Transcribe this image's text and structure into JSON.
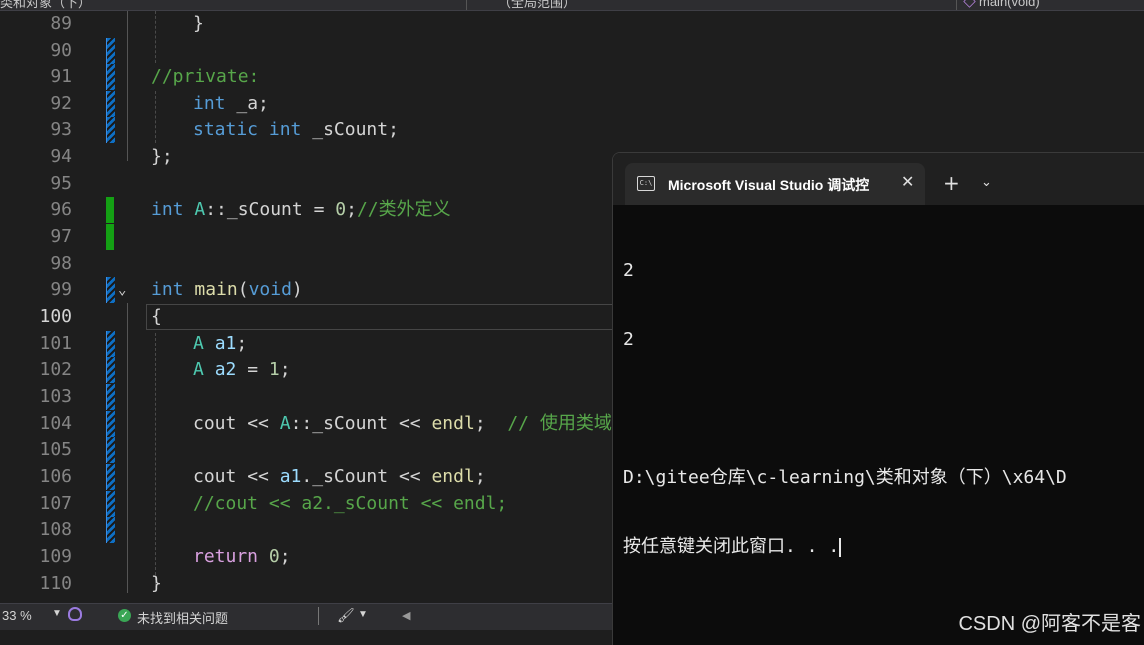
{
  "nav": {
    "class_combo": "类和对象（下）",
    "scope_combo": "（全局范围）",
    "member_combo": "main(void)"
  },
  "editor": {
    "current_line": "100",
    "lines": [
      {
        "n": "89"
      },
      {
        "n": "90"
      },
      {
        "n": "91"
      },
      {
        "n": "92"
      },
      {
        "n": "93"
      },
      {
        "n": "94"
      },
      {
        "n": "95"
      },
      {
        "n": "96"
      },
      {
        "n": "97"
      },
      {
        "n": "98"
      },
      {
        "n": "99"
      },
      {
        "n": "100"
      },
      {
        "n": "101"
      },
      {
        "n": "102"
      },
      {
        "n": "103"
      },
      {
        "n": "104"
      },
      {
        "n": "105"
      },
      {
        "n": "106"
      },
      {
        "n": "107"
      },
      {
        "n": "108"
      },
      {
        "n": "109"
      },
      {
        "n": "110"
      }
    ],
    "code": {
      "l89_brace": "}",
      "l91_comment": "//private:",
      "l92_kw": "int",
      "l92_rest": " _a;",
      "l93_kw1": "static",
      "l93_kw2": "int",
      "l93_rest": " _sCount;",
      "l94": "};",
      "l96_kw": "int",
      "l96_type": "A",
      "l96_rest": "::_sCount = ",
      "l96_num": "0",
      "l96_semi": ";",
      "l96_comment": "//类外定义",
      "l99_kw": "int",
      "l99_fn": "main",
      "l99_open": "(",
      "l99_void": "void",
      "l99_close": ")",
      "l100": "{",
      "l101_type": "A",
      "l101_var": "a1",
      "l101_semi": ";",
      "l102_type": "A",
      "l102_var": "a2",
      "l102_eq": " = ",
      "l102_num": "1",
      "l102_semi": ";",
      "l104_cout": "cout",
      "l104_op1": " << ",
      "l104_type": "A",
      "l104_member": "::_sCount",
      "l104_op2": " << ",
      "l104_endl": "endl",
      "l104_semi": ";  ",
      "l104_comment": "// 使用类域",
      "l106_cout": "cout",
      "l106_op1": " << ",
      "l106_var": "a1",
      "l106_member": "._sCount",
      "l106_op2": " << ",
      "l106_endl": "endl",
      "l106_semi": ";",
      "l107_comment": "//cout << a2._sCount << endl;",
      "l109_kw": "return",
      "l109_num": "0",
      "l109_semi": ";",
      "l110": "}"
    }
  },
  "statusbar": {
    "zoom": "33 %",
    "issues": "未找到相关问题"
  },
  "terminal": {
    "tab_title": "Microsoft Visual Studio 调试控",
    "icon_label": "C:\\",
    "output": [
      "2",
      "2",
      "",
      "D:\\gitee仓库\\c-learning\\类和对象（下）\\x64\\D",
      "按任意键关闭此窗口. . ."
    ]
  },
  "watermark": "CSDN @阿客不是客",
  "colors": {
    "editor_bg": "#1e1e1e",
    "terminal_bg": "#0c0c0c",
    "keyword": "#569cd6",
    "comment": "#57a64a",
    "function": "#dcdcaa",
    "number": "#b5cea8",
    "type": "#4ec9b0"
  },
  "icons": [
    "chevron-down-icon",
    "terminal-icon",
    "close-icon",
    "plus-icon",
    "check-circle-icon",
    "brush-icon",
    "ghost-icon"
  ]
}
